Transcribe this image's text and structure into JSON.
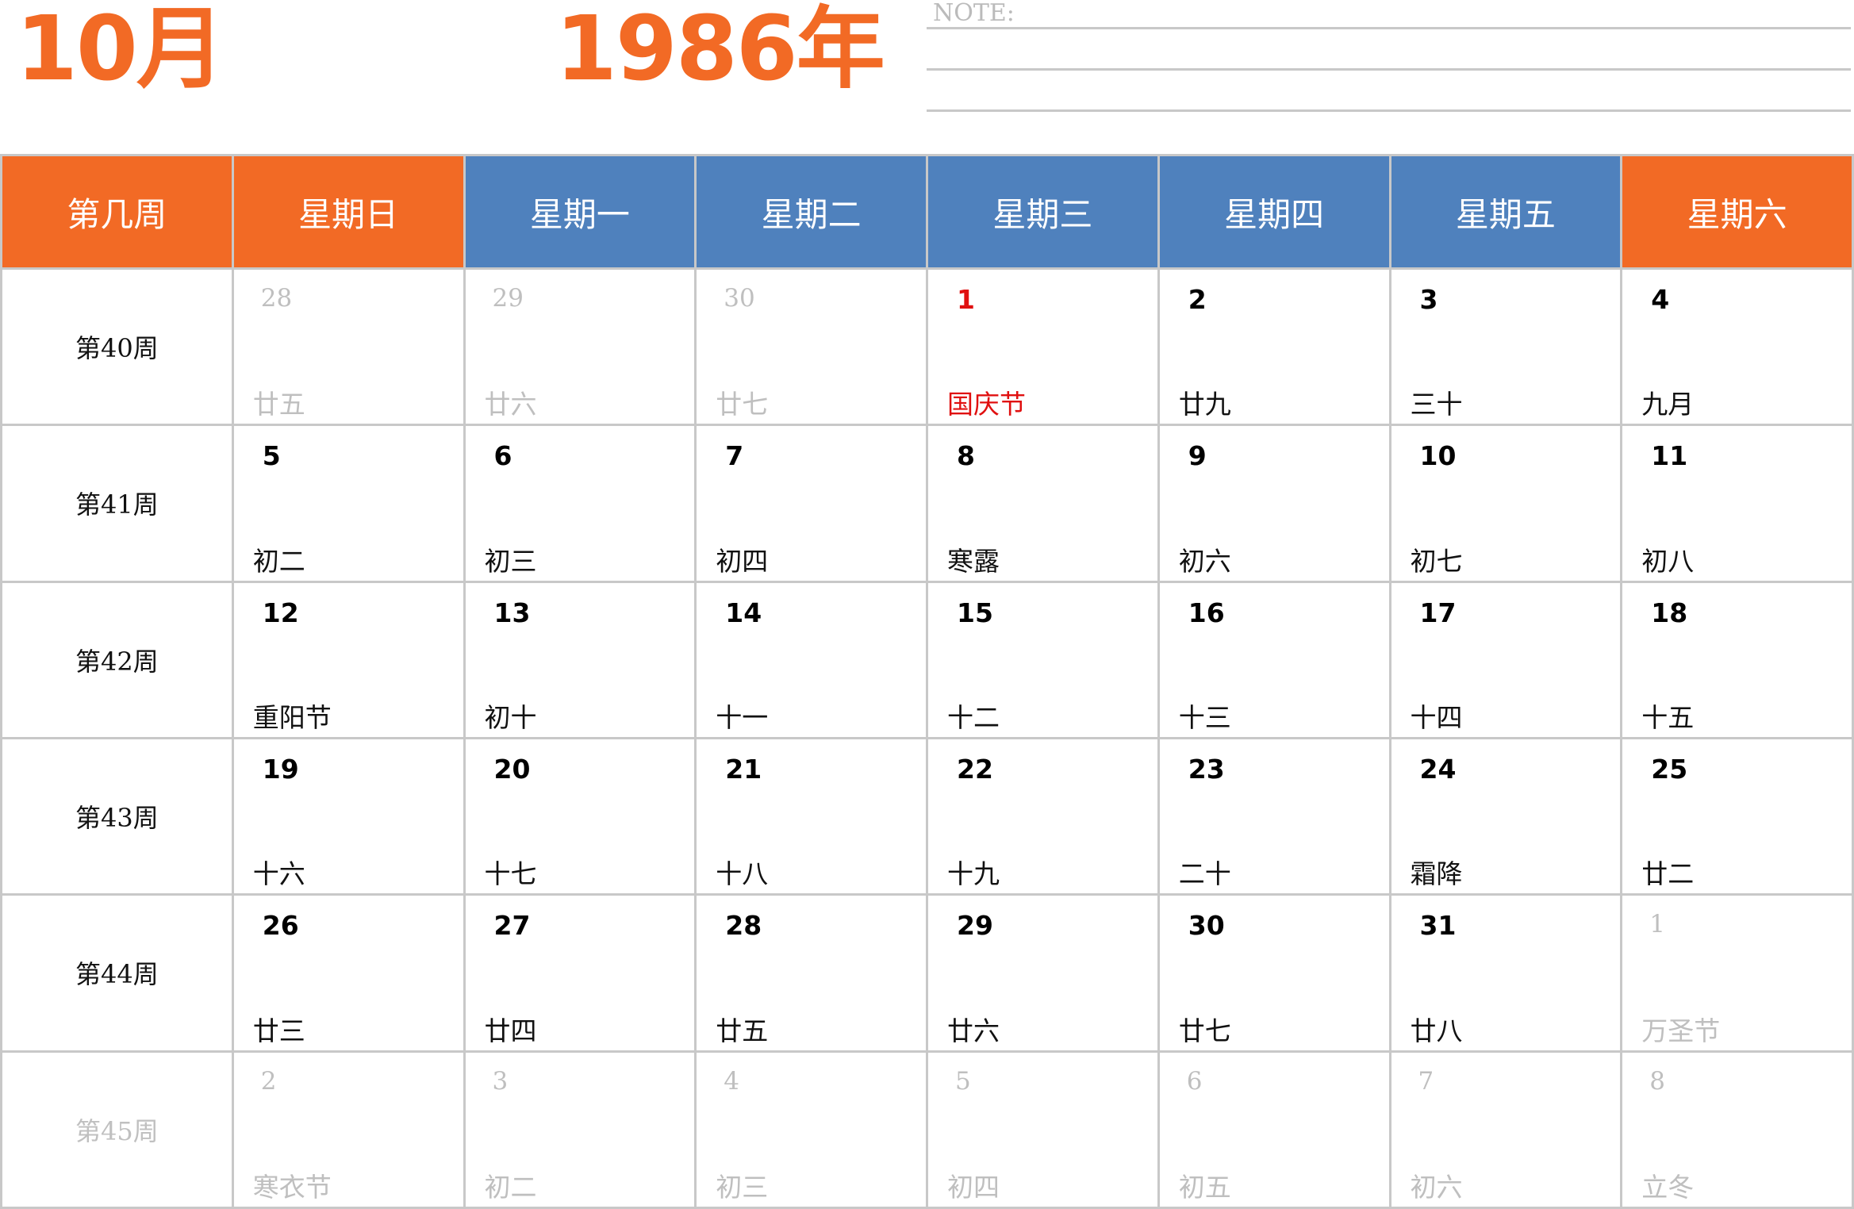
{
  "header": {
    "month": "10月",
    "year": "1986年",
    "note_label": "NOTE:"
  },
  "colors": {
    "accent_orange": "#f26a25",
    "accent_blue": "#4f81bd",
    "holiday_red": "#e01010",
    "muted_gray": "#bfbfbf"
  },
  "weekdays": [
    "第几周",
    "星期日",
    "星期一",
    "星期二",
    "星期三",
    "星期四",
    "星期五",
    "星期六"
  ],
  "weeks": [
    {
      "label": "第40周",
      "days": [
        {
          "n": "28",
          "l": "廿五"
        },
        {
          "n": "29",
          "l": "廿六"
        },
        {
          "n": "30",
          "l": "廿七"
        },
        {
          "n": "1",
          "l": "国庆节"
        },
        {
          "n": "2",
          "l": "廿九"
        },
        {
          "n": "3",
          "l": "三十"
        },
        {
          "n": "4",
          "l": "九月"
        }
      ]
    },
    {
      "label": "第41周",
      "days": [
        {
          "n": "5",
          "l": "初二"
        },
        {
          "n": "6",
          "l": "初三"
        },
        {
          "n": "7",
          "l": "初四"
        },
        {
          "n": "8",
          "l": "寒露"
        },
        {
          "n": "9",
          "l": "初六"
        },
        {
          "n": "10",
          "l": "初七"
        },
        {
          "n": "11",
          "l": "初八"
        }
      ]
    },
    {
      "label": "第42周",
      "days": [
        {
          "n": "12",
          "l": "重阳节"
        },
        {
          "n": "13",
          "l": "初十"
        },
        {
          "n": "14",
          "l": "十一"
        },
        {
          "n": "15",
          "l": "十二"
        },
        {
          "n": "16",
          "l": "十三"
        },
        {
          "n": "17",
          "l": "十四"
        },
        {
          "n": "18",
          "l": "十五"
        }
      ]
    },
    {
      "label": "第43周",
      "days": [
        {
          "n": "19",
          "l": "十六"
        },
        {
          "n": "20",
          "l": "十七"
        },
        {
          "n": "21",
          "l": "十八"
        },
        {
          "n": "22",
          "l": "十九"
        },
        {
          "n": "23",
          "l": "二十"
        },
        {
          "n": "24",
          "l": "霜降"
        },
        {
          "n": "25",
          "l": "廿二"
        }
      ]
    },
    {
      "label": "第44周",
      "days": [
        {
          "n": "26",
          "l": "廿三"
        },
        {
          "n": "27",
          "l": "廿四"
        },
        {
          "n": "28",
          "l": "廿五"
        },
        {
          "n": "29",
          "l": "廿六"
        },
        {
          "n": "30",
          "l": "廿七"
        },
        {
          "n": "31",
          "l": "廿八"
        },
        {
          "n": "1",
          "l": "万圣节"
        }
      ]
    },
    {
      "label": "第45周",
      "days": [
        {
          "n": "2",
          "l": "寒衣节"
        },
        {
          "n": "3",
          "l": "初二"
        },
        {
          "n": "4",
          "l": "初三"
        },
        {
          "n": "5",
          "l": "初四"
        },
        {
          "n": "6",
          "l": "初五"
        },
        {
          "n": "7",
          "l": "初六"
        },
        {
          "n": "8",
          "l": "立冬"
        }
      ]
    }
  ]
}
